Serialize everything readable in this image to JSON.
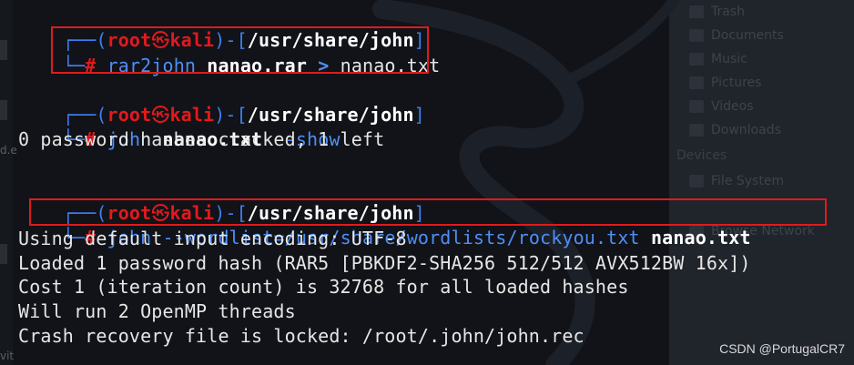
{
  "file_manager": {
    "places": [
      "Trash",
      "Documents",
      "Music",
      "Pictures",
      "Videos",
      "Downloads"
    ],
    "devices_heading": "Devices",
    "devices": [
      "File System"
    ],
    "network": "Browse Network"
  },
  "prompt": {
    "frame_top": "┌──(",
    "user": "root",
    "skull": "㉿",
    "host": "kali",
    "mid": ")-[",
    "cwd": "/usr/share/john",
    "end": "]",
    "frame_bottom": "└─",
    "symbol": "#"
  },
  "commands": [
    {
      "cmd": "rar2john",
      "arg_bold": "nanao.rar",
      "operator": ">",
      "tail": "nanao.txt"
    },
    {
      "cmd": "john",
      "arg_bold": "nanao.txt",
      "option": "--show",
      "output": [
        "0 password hashes cracked, 1 left"
      ]
    },
    {
      "cmd": "john",
      "option": "--wordlist=/usr/share/wordlists/rockyou.txt",
      "arg_bold": "nanao.txt",
      "output": [
        "Using default input encoding: UTF-8",
        "Loaded 1 password hash (RAR5 [PBKDF2-SHA256 512/512 AVX512BW 16x])",
        "Cost 1 (iteration count) is 32768 for all loaded hashes",
        "Will run 2 OpenMP threads",
        "Crash recovery file is locked: /root/.john/john.rec"
      ]
    }
  ],
  "left_panel": {
    "labels": [
      "d.e",
      "vit"
    ]
  },
  "watermark": "CSDN @PortugalCR7",
  "colors": {
    "background": "#111318",
    "prompt_frame": "#3f7ef0",
    "root_user": "#e3191c",
    "command": "#4f8ef7",
    "highlight_box": "#e01b1b"
  }
}
